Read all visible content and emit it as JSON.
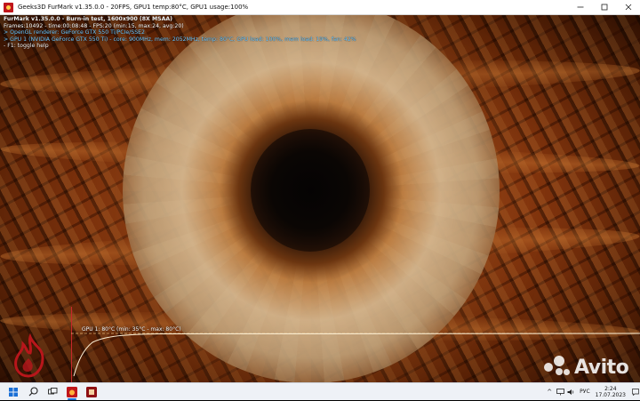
{
  "window": {
    "title": "Geeks3D FurMark v1.35.0.0 - 20FPS, GPU1 temp:80°C, GPU1 usage:100%",
    "minimize_icon": "minimize-icon",
    "maximize_icon": "maximize-icon",
    "close_icon": "close-icon"
  },
  "osd": {
    "header": "FurMark v1.35.0.0 - Burn-in test, 1600x900 (8X MSAA)",
    "frames": "Frames:10492 - time:00:08:48 - FPS:20 (min:15, max:24, avg:20)",
    "renderer": "> OpenGL renderer: GeForce GTX 550 Ti/PCIe/SSE2",
    "gpu": "> GPU 1 (NVIDIA GeForce GTX 550 Ti) - core: 900MHz, mem: 2052MHz, temp: 80°C, GPU load: 100%, mem load: 19%, fan: 42%",
    "help": "- F1: toggle help"
  },
  "graph": {
    "label": "GPU 1: 80°C (min: 35°C - max: 80°C)",
    "min_temp": 35,
    "max_temp": 80,
    "current_temp": 80
  },
  "watermark": {
    "text": "Avito"
  },
  "taskbar": {
    "start_icon": "windows-start-icon",
    "search_icon": "search-icon",
    "taskview_icon": "task-view-icon",
    "apps": [
      {
        "name": "furmark-app-icon",
        "active": true
      },
      {
        "name": "furmark-gpu-app-icon",
        "active": false
      }
    ],
    "tray": {
      "chevron": "^",
      "language": "РУС",
      "time": "2:24",
      "date": "17.07.2023"
    }
  },
  "colors": {
    "osd_info": "#6fc8ff",
    "graph_axis": "#c7272b",
    "graph_line": "#ffd28a",
    "taskbar_bg": "#eef1f6"
  }
}
